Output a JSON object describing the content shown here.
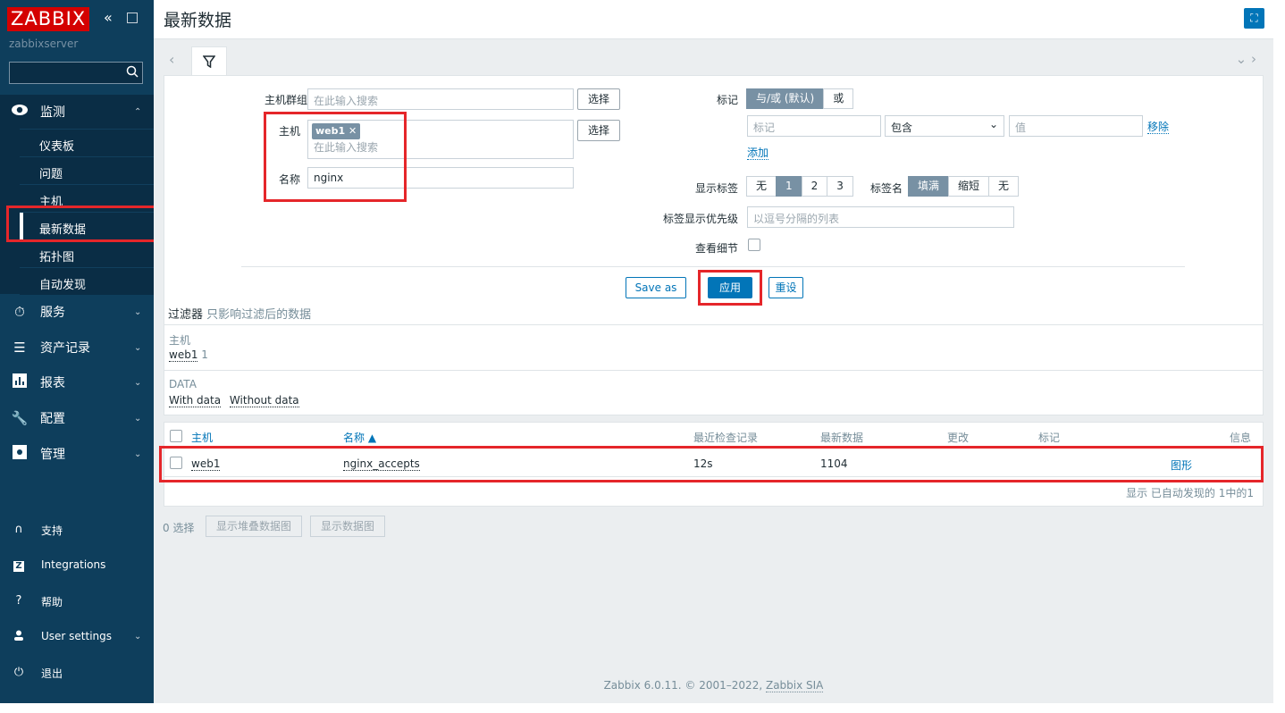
{
  "app": {
    "logo": "ZABBIX",
    "server": "zabbixserver"
  },
  "sidebar": {
    "monitoring": "监测",
    "sub": [
      "仪表板",
      "问题",
      "主机",
      "最新数据",
      "拓扑图",
      "自动发现"
    ],
    "services": "服务",
    "inventory": "资产记录",
    "reports": "报表",
    "config": "配置",
    "admin": "管理",
    "support": "支持",
    "integrations": "Integrations",
    "help": "帮助",
    "user_settings": "User settings",
    "logout": "退出"
  },
  "header": {
    "title": "最新数据"
  },
  "filter": {
    "hostgroup_label": "主机群组",
    "hostgroup_placeholder": "在此输入搜索",
    "select": "选择",
    "host_label": "主机",
    "host_tag": "web1",
    "host_placeholder": "在此输入搜索",
    "name_label": "名称",
    "name_value": "nginx",
    "tags_label": "标记",
    "tags_andor": "与/或 (默认)",
    "tags_or": "或",
    "tag_placeholder": "标记",
    "tag_operator": "包含",
    "value_placeholder": "值",
    "remove": "移除",
    "add": "添加",
    "show_tags_label": "显示标签",
    "show_tags_options": [
      "无",
      "1",
      "2",
      "3"
    ],
    "tag_name_label": "标签名",
    "tag_name_options": [
      "填满",
      "缩短",
      "无"
    ],
    "tag_priority_label": "标签显示优先级",
    "tag_priority_placeholder": "以逗号分隔的列表",
    "show_details_label": "查看细节",
    "save_as": "Save as",
    "apply": "应用",
    "reset": "重设"
  },
  "subfilter": {
    "title": "过滤器",
    "hint": "只影响过滤后的数据",
    "host_title": "主机",
    "host_item": "web1",
    "host_count": "1",
    "data_title": "DATA",
    "with_data": "With data",
    "without_data": "Without data"
  },
  "table": {
    "columns": [
      "主机",
      "名称 ▲",
      "最近检查记录",
      "最新数据",
      "更改",
      "标记",
      "信息"
    ],
    "rows": [
      {
        "host": "web1",
        "name": "nginx_accepts",
        "last_check": "12s",
        "last_value": "1104",
        "change": "",
        "graph": "图形"
      }
    ],
    "summary": "显示 已自动发现的 1中的1"
  },
  "actions": {
    "selected": "0 选择",
    "stacked": "显示堆叠数据图",
    "graph": "显示数据图"
  },
  "footer": {
    "text": "Zabbix 6.0.11. © 2001–2022,",
    "company": "Zabbix SIA"
  }
}
